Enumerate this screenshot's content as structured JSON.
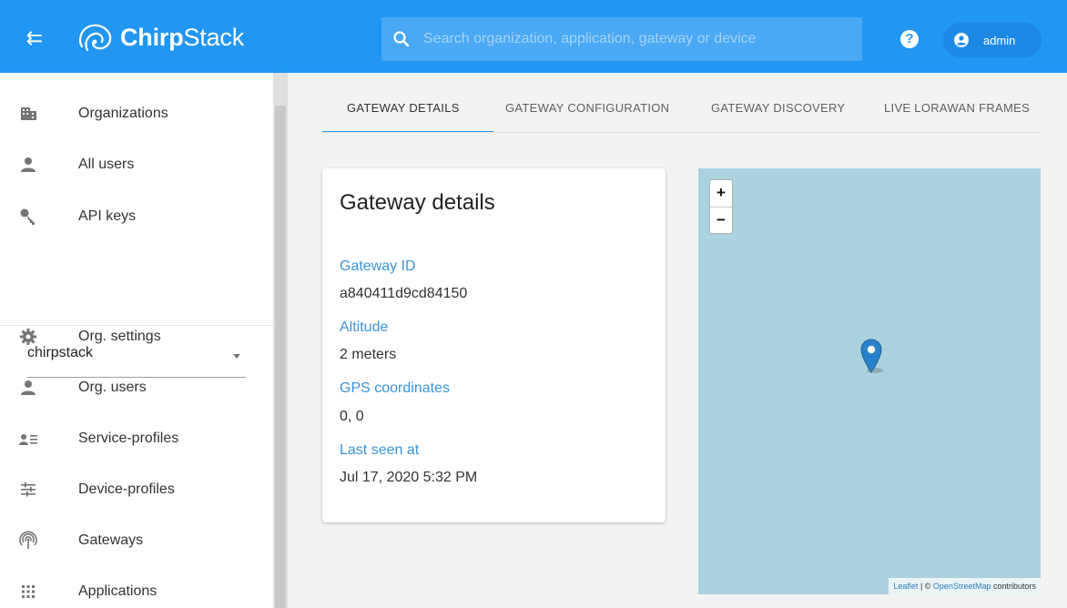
{
  "topbar": {
    "brand_bold": "Chirp",
    "brand_rest": "Stack",
    "search_placeholder": "Search organization, application, gateway or device",
    "user": "admin"
  },
  "sidebar": {
    "items_top": [
      {
        "label": "Organizations",
        "icon": "organizations-icon"
      },
      {
        "label": "All users",
        "icon": "user-icon"
      },
      {
        "label": "API keys",
        "icon": "key-icon"
      }
    ],
    "org_selected": "chirpstack",
    "items_org": [
      {
        "label": "Org. settings",
        "icon": "gear-icon"
      },
      {
        "label": "Org. users",
        "icon": "user-icon"
      },
      {
        "label": "Service-profiles",
        "icon": "service-profiles-icon"
      },
      {
        "label": "Device-profiles",
        "icon": "device-profiles-icon"
      },
      {
        "label": "Gateways",
        "icon": "gateway-icon"
      },
      {
        "label": "Applications",
        "icon": "applications-grid-icon"
      }
    ]
  },
  "tabs": [
    "GATEWAY DETAILS",
    "GATEWAY CONFIGURATION",
    "GATEWAY DISCOVERY",
    "LIVE LORAWAN FRAMES"
  ],
  "details": {
    "title": "Gateway details",
    "fields": [
      {
        "label": "Gateway ID",
        "value": "a840411d9cd84150"
      },
      {
        "label": "Altitude",
        "value": "2 meters"
      },
      {
        "label": "GPS coordinates",
        "value": "0, 0"
      },
      {
        "label": "Last seen at",
        "value": "Jul 17, 2020 5:32 PM"
      }
    ]
  },
  "map": {
    "zoom_in": "+",
    "zoom_out": "−",
    "attr_leaflet": "Leaflet",
    "attr_sep": " | © ",
    "attr_osm": "OpenStreetMap",
    "attr_rest": " contributors"
  },
  "colors": {
    "primary": "#2196f3",
    "label_blue": "#3b93d9",
    "map_water": "#aad3df",
    "marker": "#2a81cb"
  }
}
